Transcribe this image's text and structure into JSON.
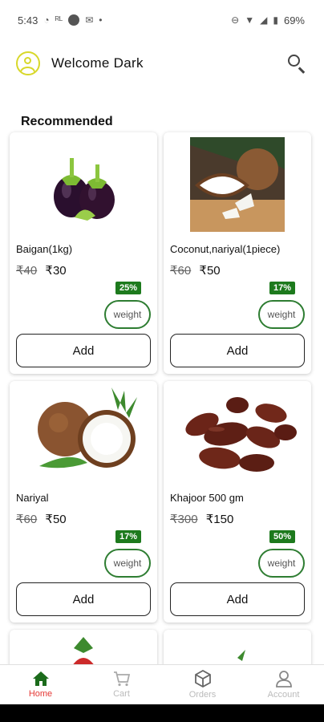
{
  "status_bar": {
    "time": "5:43",
    "battery": "69%"
  },
  "header": {
    "welcome_text": "Welcome  Dark"
  },
  "section": {
    "title": "Recommended"
  },
  "products": [
    {
      "name": "Baigan(1kg)",
      "old_price": "₹40",
      "price": "₹30",
      "discount": "25%",
      "weight_label": "weight",
      "add_label": "Add"
    },
    {
      "name": "Coconut,nariyal(1piece)",
      "old_price": "₹60",
      "price": "₹50",
      "discount": "17%",
      "weight_label": "weight",
      "add_label": "Add"
    },
    {
      "name": "Nariyal",
      "old_price": "₹60",
      "price": "₹50",
      "discount": "17%",
      "weight_label": "weight",
      "add_label": "Add"
    },
    {
      "name": "Khajoor 500 gm",
      "old_price": "₹300",
      "price": "₹150",
      "discount": "50%",
      "weight_label": "weight",
      "add_label": "Add"
    }
  ],
  "nav": {
    "active_color": "#e53935",
    "items": [
      {
        "label": "Home",
        "icon": "home-icon"
      },
      {
        "label": "Cart",
        "icon": "cart-icon"
      },
      {
        "label": "Orders",
        "icon": "box-icon"
      },
      {
        "label": "Account",
        "icon": "person-icon"
      }
    ]
  }
}
